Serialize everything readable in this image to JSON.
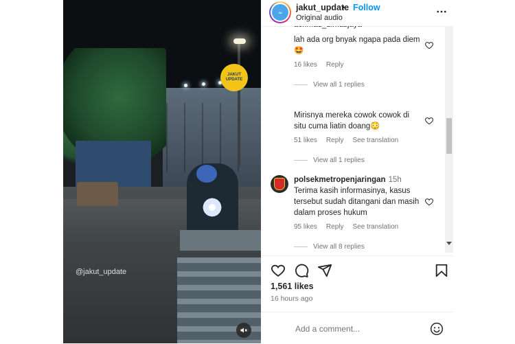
{
  "video": {
    "watermark": "@jakut_update",
    "logo_text": "JAKUT UPDATE"
  },
  "post": {
    "username": "jakut_update",
    "separator": "•",
    "follow_label": "Follow",
    "audio": "Original audio",
    "likes": "1,561 likes",
    "time_ago": "16 hours ago",
    "add_comment_placeholder": "Add a comment..."
  },
  "comments": [
    {
      "username": "achmad_dimasjaya",
      "text": "lah ada org bnyak ngapa pada diem 🤩",
      "likes": "16 likes",
      "reply": "Reply",
      "view_replies": "View all 1 replies"
    },
    {
      "text": "Mirisnya mereka cowok cowok di situ cuma liatin doang😳",
      "likes": "51 likes",
      "reply": "Reply",
      "translation": "See translation",
      "view_replies": "View all 1 replies"
    },
    {
      "username": "polsekmetropenjaringan",
      "time": "15h",
      "text": "Terima kasih informasinya, kasus tersebut sudah ditangani dan masih dalam proses hukum",
      "likes": "95 likes",
      "reply": "Reply",
      "translation": "See translation",
      "view_replies": "View all 8 replies"
    }
  ],
  "icons": {
    "like": "heart-icon",
    "comment": "comment-icon",
    "share": "share-icon",
    "save": "bookmark-icon",
    "mute": "mute-icon",
    "emoji": "emoji-icon",
    "more": "more-icon"
  },
  "colors": {
    "accent": "#0095f6",
    "text": "#262626",
    "secondary": "#737373"
  }
}
